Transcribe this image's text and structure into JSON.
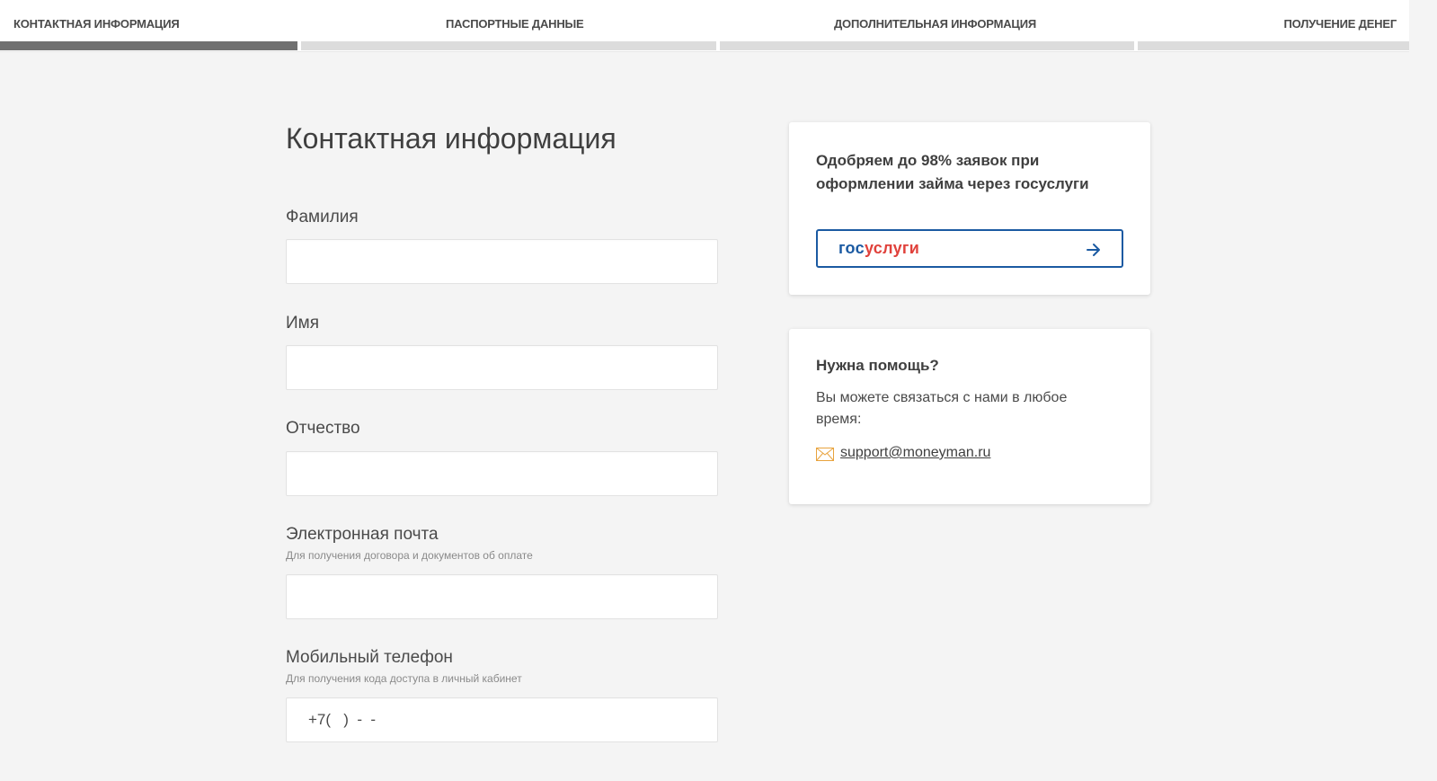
{
  "steps": [
    {
      "label": "КОНТАКТНАЯ ИНФОРМАЦИЯ",
      "active": true
    },
    {
      "label": "ПАСПОРТНЫЕ ДАННЫЕ",
      "active": false
    },
    {
      "label": "ДОПОЛНИТЕЛЬНАЯ ИНФОРМАЦИЯ",
      "active": false
    },
    {
      "label": "ПОЛУЧЕНИЕ ДЕНЕГ",
      "active": false
    }
  ],
  "form": {
    "title": "Контактная информация",
    "surname": {
      "label": "Фамилия",
      "value": ""
    },
    "name": {
      "label": "Имя",
      "value": ""
    },
    "patronymic": {
      "label": "Отчество",
      "value": ""
    },
    "email": {
      "label": "Электронная почта",
      "hint": "Для получения договора и документов об оплате",
      "value": ""
    },
    "phone": {
      "label": "Мобильный телефон",
      "hint": "Для получения кода доступа в личный кабинет",
      "mask": "+7(   )  -  -"
    }
  },
  "promo": {
    "text": "Одобряем до 98% заявок при оформлении займа через госуслуги",
    "logo_part1": "гос",
    "logo_part2": "услуги",
    "arrow_icon": "arrow-right-icon",
    "colors": {
      "brand_blue": "#1b5aa2",
      "brand_red": "#e0413b"
    }
  },
  "help": {
    "title": "Нужна помощь?",
    "text": "Вы можете связаться с нами в любое время:",
    "email": "support@moneyman.ru",
    "mail_icon": "envelope-icon",
    "colors": {
      "mail_icon": "#e8a33d"
    }
  }
}
